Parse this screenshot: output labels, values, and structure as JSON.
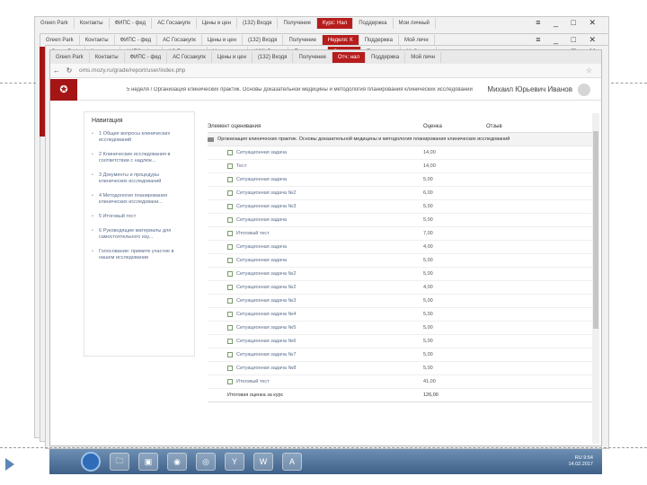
{
  "back_windows": {
    "tabs_1": [
      "Green Park",
      "Контакты",
      "ФИПС - фед",
      "АС Госзакупк",
      "Цены и цен",
      "(132) Входя",
      "Получение",
      "Курс: Нал",
      "Поддержка",
      "Мои личный"
    ],
    "tabs_2": [
      "Green Park",
      "Контакты",
      "ФИПС - фед",
      "АС Госзакупк",
      "Цены и цен",
      "(132) Входя",
      "Получение",
      "Неделя: К",
      "Поддержка",
      "Мой личн"
    ],
    "tabs_3": [
      "Green Park",
      "Контакты",
      "ФИПС - фед",
      "АС Госзакупк",
      "Цены и цен",
      "(132) Входя",
      "Получение",
      "Отч: нал",
      "Поддержка",
      "Мой личн"
    ],
    "window_controls": "≡ _ □ ✕",
    "left_heading": "На"
  },
  "browser": {
    "back": "←",
    "reload": "↻",
    "url": "oms.mozy.ru/grade/report/user/index.php",
    "star": "☆"
  },
  "header": {
    "logo": "✪",
    "breadcrumb": "5 неделя / Организация клинических практик. Основы доказательной медицины и методология планирования клинических исследований",
    "user_name": "Михаил Юрьевич Иванов"
  },
  "navigation": {
    "title": "Навигация",
    "items": [
      "1 Общие вопросы клинических исследований",
      "2 Клинические исследования в соответствии с надлеж...",
      "3 Документы и процедуры клинических исследований",
      "4 Методология планирования клинических исследовани...",
      "5 Итоговый тест",
      "6 Руководящие материалы для самостоятельного изу...",
      "Голосование: примите участие в нашем исследовании"
    ]
  },
  "grades": {
    "col_item": "Элемент оценивания",
    "col_grade": "Оценка",
    "col_feedback": "Отзыв",
    "category": "Организация клинических практик. Основы доказательной медицины и методология планирования клинических исследований",
    "rows": [
      {
        "name": "Ситуационная задача",
        "grade": "14,00"
      },
      {
        "name": "Тест",
        "grade": "14,00"
      },
      {
        "name": "Ситуационная задача",
        "grade": "5,00"
      },
      {
        "name": "Ситуационная задача №2",
        "grade": "6,00"
      },
      {
        "name": "Ситуационная задача №3",
        "grade": "5,00"
      },
      {
        "name": "Ситуационная задача",
        "grade": "5,00"
      },
      {
        "name": "Итоговый тест",
        "grade": "7,00"
      },
      {
        "name": "Ситуационная задача",
        "grade": "4,00"
      },
      {
        "name": "Ситуационная задача",
        "grade": "5,00"
      },
      {
        "name": "Ситуационная задача №2",
        "grade": "5,00"
      },
      {
        "name": "Ситуационная задача №2",
        "grade": "4,00"
      },
      {
        "name": "Ситуационная задача №3",
        "grade": "5,00"
      },
      {
        "name": "Ситуационная задача №4",
        "grade": "5,00"
      },
      {
        "name": "Ситуационная задача №5",
        "grade": "5,00"
      },
      {
        "name": "Ситуационная задача №6",
        "grade": "5,00"
      },
      {
        "name": "Ситуационная задача №7",
        "grade": "5,00"
      },
      {
        "name": "Ситуационная задача №8",
        "grade": "5,00"
      },
      {
        "name": "Итоговый тест",
        "grade": "41,00"
      }
    ],
    "total_label": "Итоговая оценка за курс",
    "total_grade": "126,00"
  },
  "taskbar": {
    "icons": [
      "🗀",
      "▣",
      "◉",
      "◎",
      "Y",
      "W",
      "A"
    ],
    "tray_lang": "RU",
    "time": "9:54",
    "date": "14.02.2017"
  }
}
